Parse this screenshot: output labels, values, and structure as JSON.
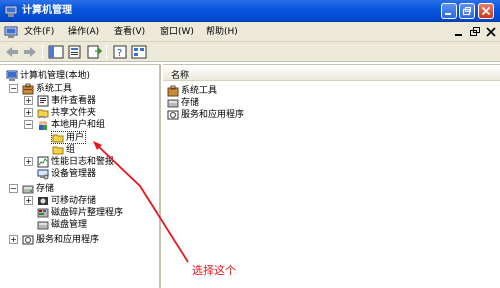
{
  "window": {
    "title": "计算机管理"
  },
  "menu": [
    {
      "label": "文件(F)"
    },
    {
      "label": "操作(A)"
    },
    {
      "label": "查看(V)"
    },
    {
      "label": "窗口(W)"
    },
    {
      "label": "帮助(H)"
    }
  ],
  "tree": {
    "root": "计算机管理(本地)",
    "system_tools": "系统工具",
    "event_viewer": "事件查看器",
    "shared_folders": "共享文件夹",
    "local_users": "本地用户和组",
    "users": "用户",
    "groups": "组",
    "perf_logs": "性能日志和警报",
    "device_manager": "设备管理器",
    "storage": "存储",
    "removable": "可移动存储",
    "defrag": "磁盘碎片整理程序",
    "disk_mgmt": "磁盘管理",
    "services": "服务和应用程序"
  },
  "list": {
    "column": "名称",
    "items": [
      {
        "label": "系统工具"
      },
      {
        "label": "存储"
      },
      {
        "label": "服务和应用程序"
      }
    ]
  },
  "annotation": {
    "text": "选择这个",
    "color": "#e8161e"
  },
  "colors": {
    "titlebar": "#0a58e0",
    "chrome": "#ece9d8",
    "annotation": "#e8161e"
  }
}
